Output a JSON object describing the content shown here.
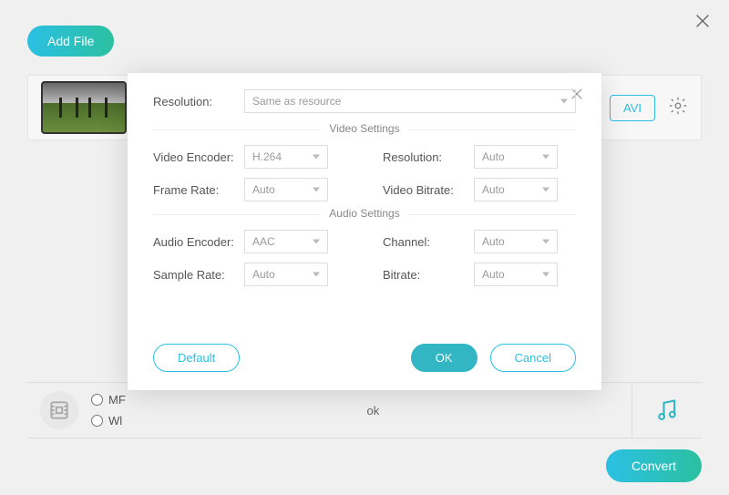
{
  "background": {
    "add_file_label": "Add File",
    "avi_label": "AVI",
    "mp_label": "MF",
    "wl_label": "Wl",
    "ok_label": "ok",
    "convert_label": "Convert"
  },
  "modal": {
    "top_resolution_label": "Resolution:",
    "top_resolution_value": "Same as resource",
    "video_section": "Video Settings",
    "audio_section": "Audio Settings",
    "fields": {
      "video_encoder_label": "Video Encoder:",
      "video_encoder_value": "H.264",
      "frame_rate_label": "Frame Rate:",
      "frame_rate_value": "Auto",
      "resolution_label": "Resolution:",
      "resolution_value": "Auto",
      "video_bitrate_label": "Video Bitrate:",
      "video_bitrate_value": "Auto",
      "audio_encoder_label": "Audio Encoder:",
      "audio_encoder_value": "AAC",
      "sample_rate_label": "Sample Rate:",
      "sample_rate_value": "Auto",
      "channel_label": "Channel:",
      "channel_value": "Auto",
      "bitrate_label": "Bitrate:",
      "bitrate_value": "Auto"
    },
    "default_label": "Default",
    "ok_label": "OK",
    "cancel_label": "Cancel"
  }
}
